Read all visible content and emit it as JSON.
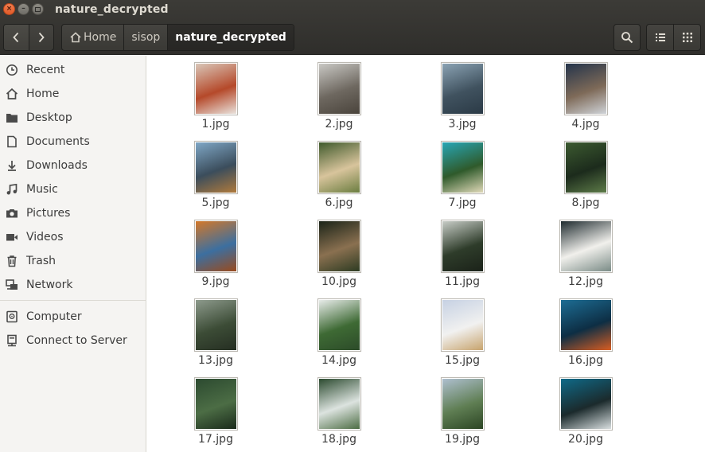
{
  "window": {
    "title": "nature_decrypted"
  },
  "path_bar": {
    "crumbs": [
      {
        "label": "Home",
        "icon": "home-icon"
      },
      {
        "label": "sisop"
      },
      {
        "label": "nature_decrypted"
      }
    ]
  },
  "sidebar": {
    "items": [
      {
        "label": "Recent",
        "icon": "clock-icon"
      },
      {
        "label": "Home",
        "icon": "home-icon"
      },
      {
        "label": "Desktop",
        "icon": "folder-icon"
      },
      {
        "label": "Documents",
        "icon": "document-icon"
      },
      {
        "label": "Downloads",
        "icon": "download-icon"
      },
      {
        "label": "Music",
        "icon": "music-icon"
      },
      {
        "label": "Pictures",
        "icon": "camera-icon"
      },
      {
        "label": "Videos",
        "icon": "video-icon"
      },
      {
        "label": "Trash",
        "icon": "trash-icon"
      },
      {
        "label": "Network",
        "icon": "network-icon"
      },
      {
        "label": "Computer",
        "icon": "computer-icon"
      },
      {
        "label": "Connect to Server",
        "icon": "server-icon"
      }
    ]
  },
  "files": [
    {
      "name": "1.jpg",
      "colors": [
        "#d9c6b8",
        "#b5492a",
        "#e9e3dd"
      ]
    },
    {
      "name": "2.jpg",
      "colors": [
        "#c9c8c4",
        "#6e6860",
        "#4a443c"
      ]
    },
    {
      "name": "3.jpg",
      "colors": [
        "#8aa2b3",
        "#40525f",
        "#2b3a46"
      ]
    },
    {
      "name": "4.jpg",
      "colors": [
        "#24344b",
        "#7e6a58",
        "#cfd3d8"
      ]
    },
    {
      "name": "5.jpg",
      "colors": [
        "#7fa7c6",
        "#3b4d5c",
        "#b07a3c"
      ]
    },
    {
      "name": "6.jpg",
      "colors": [
        "#3f5a2c",
        "#d8c49c",
        "#6b7d40"
      ]
    },
    {
      "name": "7.jpg",
      "colors": [
        "#27a6b5",
        "#2f5a2b",
        "#e0d9b8"
      ]
    },
    {
      "name": "8.jpg",
      "colors": [
        "#3c5a30",
        "#1c2b1c",
        "#5d7b48"
      ]
    },
    {
      "name": "9.jpg",
      "colors": [
        "#d3782a",
        "#3c6fa0",
        "#9a4a1d"
      ]
    },
    {
      "name": "10.jpg",
      "colors": [
        "#1b2418",
        "#8a7050",
        "#2d3b22"
      ]
    },
    {
      "name": "11.jpg",
      "colors": [
        "#c7ccc6",
        "#2e3c2a",
        "#1b2219"
      ]
    },
    {
      "name": "12.jpg",
      "colors": [
        "#1f2b2f",
        "#f1f0ec",
        "#7a8b86"
      ]
    },
    {
      "name": "13.jpg",
      "colors": [
        "#8d9a8c",
        "#3c4c36",
        "#252e22"
      ]
    },
    {
      "name": "14.jpg",
      "colors": [
        "#e8ecea",
        "#3e6a34",
        "#2c4b29"
      ]
    },
    {
      "name": "15.jpg",
      "colors": [
        "#c6d1e3",
        "#f1f1f0",
        "#c7a36d"
      ]
    },
    {
      "name": "16.jpg",
      "colors": [
        "#1d6d94",
        "#0d2e44",
        "#d85d22"
      ]
    },
    {
      "name": "17.jpg",
      "colors": [
        "#2c4a30",
        "#4c6d45",
        "#1a2a1b"
      ]
    },
    {
      "name": "18.jpg",
      "colors": [
        "#2b4a2f",
        "#dce3df",
        "#4d6d44"
      ]
    },
    {
      "name": "19.jpg",
      "colors": [
        "#aebfcf",
        "#5f7e53",
        "#2c4524"
      ]
    },
    {
      "name": "20.jpg",
      "colors": [
        "#0f6a88",
        "#1b2a2c",
        "#d9dfe0"
      ]
    }
  ]
}
